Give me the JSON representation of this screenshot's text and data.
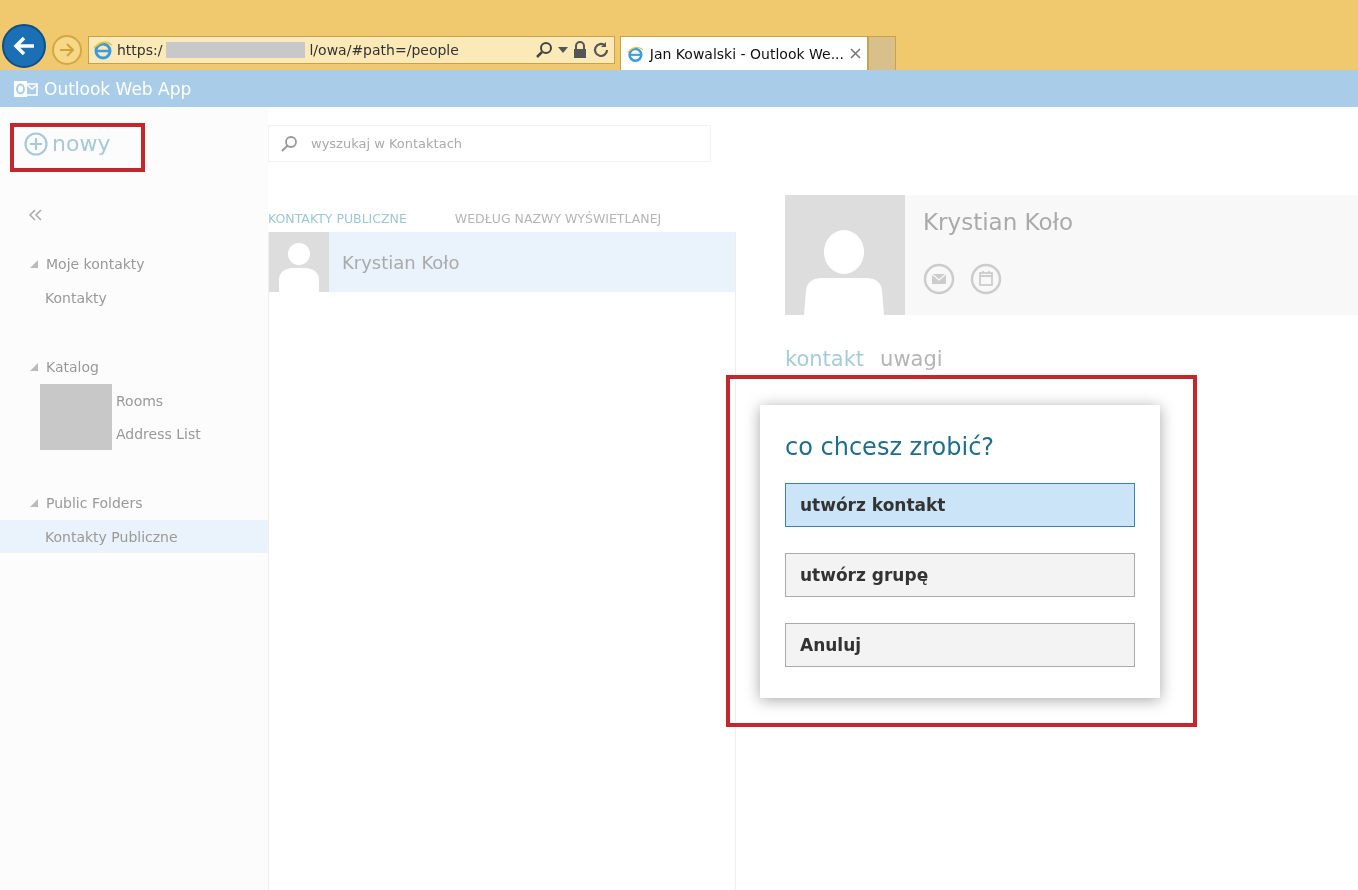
{
  "browser": {
    "url_prefix": "https:/",
    "url_suffix": "l/owa/#path=/people",
    "tab_title": "Jan Kowalski - Outlook We..."
  },
  "app_bar": {
    "title": "Outlook Web App"
  },
  "new_button": {
    "label": "nowy"
  },
  "search": {
    "placeholder": "wyszukaj w Kontaktach"
  },
  "nav": {
    "groups": [
      {
        "label": "Moje kontakty",
        "expanded": true,
        "items": [
          {
            "label": "Kontakty",
            "selected": false,
            "redacted": false
          }
        ]
      },
      {
        "label": "Katalog",
        "expanded": true,
        "items": [
          {
            "label": "Rooms",
            "selected": false,
            "redacted": true
          },
          {
            "label": "Address List",
            "selected": false,
            "redacted": true
          }
        ]
      },
      {
        "label": "Public Folders",
        "expanded": true,
        "items": [
          {
            "label": "Kontakty Publiczne",
            "selected": true,
            "redacted": false
          }
        ]
      }
    ]
  },
  "list": {
    "folder": "KONTAKTY PUBLICZNE",
    "sort": "WEDŁUG NAZWY WYŚWIETLANEJ",
    "contacts": [
      {
        "name": "Krystian Koło",
        "selected": true
      }
    ]
  },
  "detail": {
    "name": "Krystian Koło",
    "tabs": [
      {
        "label": "kontakt",
        "selected": true
      },
      {
        "label": "uwagi",
        "selected": false
      }
    ]
  },
  "dialog": {
    "title": "co chcesz zrobić?",
    "options": [
      {
        "label": "utwórz kontakt",
        "selected": true
      },
      {
        "label": "utwórz grupę",
        "selected": false
      },
      {
        "label": "Anuluj",
        "selected": false
      }
    ]
  }
}
